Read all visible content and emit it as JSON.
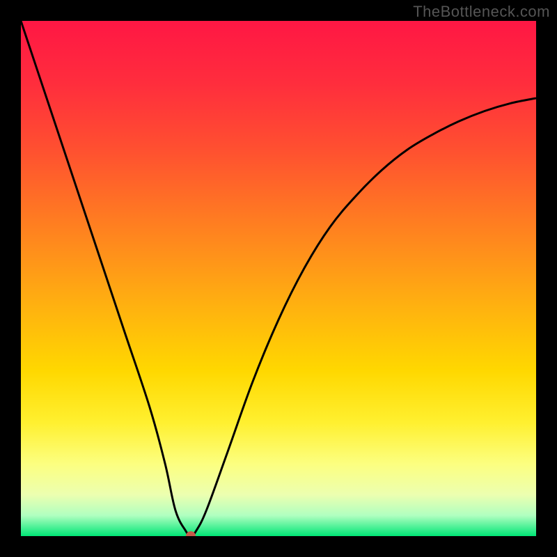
{
  "watermark": "TheBottleneck.com",
  "chart_data": {
    "type": "line",
    "title": "",
    "xlabel": "",
    "ylabel": "",
    "xlim": [
      0,
      100
    ],
    "ylim": [
      0,
      100
    ],
    "series": [
      {
        "name": "bottleneck-curve",
        "x": [
          0,
          5,
          10,
          15,
          20,
          25,
          28,
          30,
          32,
          33,
          34,
          36,
          40,
          45,
          50,
          55,
          60,
          65,
          70,
          75,
          80,
          85,
          90,
          95,
          100
        ],
        "values": [
          100,
          85,
          70,
          55,
          40,
          25,
          14,
          5,
          1,
          0,
          1,
          5,
          16,
          30,
          42,
          52,
          60,
          66,
          71,
          75,
          78,
          80.5,
          82.5,
          84,
          85
        ]
      }
    ],
    "marker": {
      "x": 33,
      "y": 0,
      "color": "#c75a4a"
    },
    "gradient_stops": [
      {
        "offset": 0,
        "color": "#ff1744"
      },
      {
        "offset": 12,
        "color": "#ff2d3d"
      },
      {
        "offset": 25,
        "color": "#ff5030"
      },
      {
        "offset": 40,
        "color": "#ff8020"
      },
      {
        "offset": 55,
        "color": "#ffb010"
      },
      {
        "offset": 68,
        "color": "#ffd800"
      },
      {
        "offset": 78,
        "color": "#fff030"
      },
      {
        "offset": 86,
        "color": "#fcff80"
      },
      {
        "offset": 92,
        "color": "#ecffb0"
      },
      {
        "offset": 96,
        "color": "#b0ffc0"
      },
      {
        "offset": 100,
        "color": "#00e676"
      }
    ]
  }
}
